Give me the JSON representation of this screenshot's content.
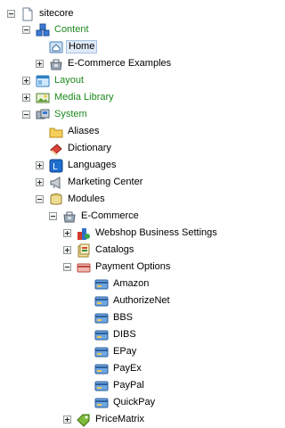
{
  "tree": {
    "root": "sitecore",
    "content": "Content",
    "home": "Home",
    "ecommerce_examples": "E-Commerce Examples",
    "layout": "Layout",
    "media_library": "Media Library",
    "system": "System",
    "aliases": "Aliases",
    "dictionary": "Dictionary",
    "languages": "Languages",
    "marketing_center": "Marketing Center",
    "modules": "Modules",
    "ecommerce": "E-Commerce",
    "webshop_business_settings": "Webshop Business Settings",
    "catalogs": "Catalogs",
    "payment_options": "Payment Options",
    "payment_items": [
      "Amazon",
      "AuthorizeNet",
      "BBS",
      "DIBS",
      "EPay",
      "PayEx",
      "PayPal",
      "QuickPay"
    ],
    "price_matrix": "PriceMatrix"
  },
  "colors": {
    "green_label": "#1e8a1e",
    "selected_bg": "#dfe9f7",
    "selected_border": "#a6c2e6"
  }
}
